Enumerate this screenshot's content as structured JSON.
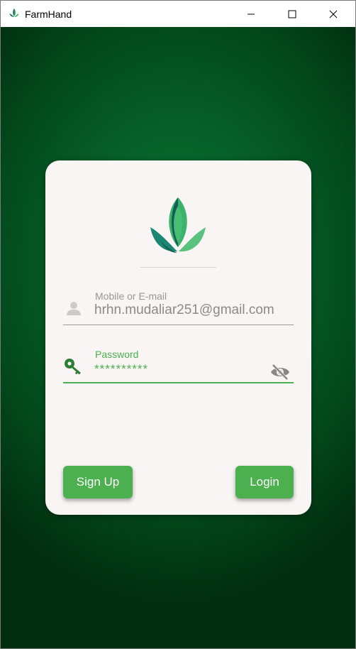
{
  "window": {
    "title": "FarmHand",
    "icon": "farmhand-leaf-icon",
    "controls": [
      "minimize-icon",
      "maximize-icon",
      "close-icon"
    ]
  },
  "colors": {
    "accent": "#4caf50",
    "background_center": "#0c7a36",
    "background_edge": "#022e10",
    "card": "#f8f5f4"
  },
  "login": {
    "logo": "farmhand-leaf-logo",
    "email": {
      "icon": "person-icon",
      "label": "Mobile or E-mail",
      "value": "hrhn.mudaliar251@gmail.com"
    },
    "password": {
      "icon": "key-icon",
      "label": "Password",
      "value": "**********",
      "toggle_icon": "eye-off-icon"
    },
    "signup_label": "Sign Up",
    "login_label": "Login"
  }
}
